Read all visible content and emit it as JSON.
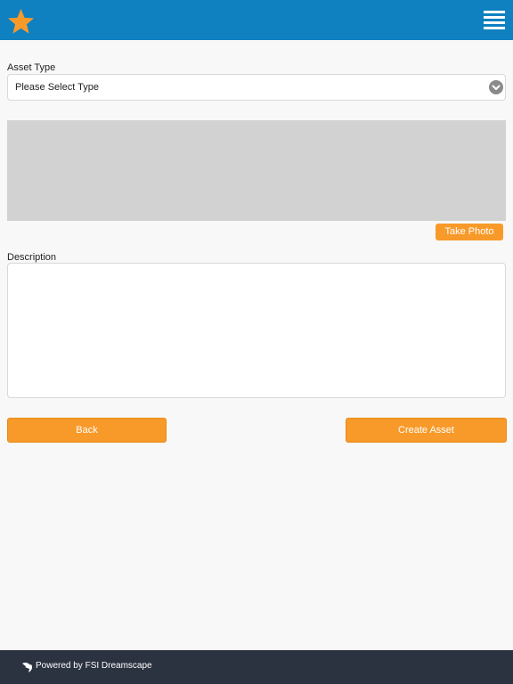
{
  "header": {
    "background_color": "#0f80c0",
    "left_icon": "star-icon",
    "right_icon": "hamburger-menu-icon",
    "star_color": "#f89a2a"
  },
  "form": {
    "asset_type": {
      "label": "Asset Type",
      "selected_value": "Please Select Type",
      "icon": "chevron-down-icon"
    },
    "photo": {
      "button_label": "Take Photo"
    },
    "description": {
      "label": "Description",
      "value": ""
    },
    "actions": {
      "back_label": "Back",
      "create_label": "Create Asset"
    },
    "accent_color": "#f89a2a"
  },
  "footer": {
    "logo_icon": "fsi-dreamscape-logo-icon",
    "text": "Powered by FSI Dreamscape",
    "background_color": "#2b3240"
  }
}
